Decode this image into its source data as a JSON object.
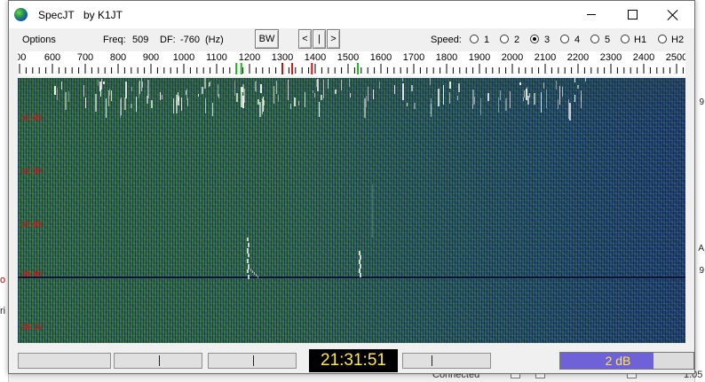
{
  "background": {
    "left_glyph": "ri",
    "left_glyph2": "o",
    "right_glyphs": [
      "9",
      "A",
      "9"
    ],
    "bottom_text": "Connected",
    "bottom_right_text": "1:05"
  },
  "window": {
    "title": "SpecJT",
    "by": "by K1JT",
    "icon": "globe-icon"
  },
  "toolbar": {
    "options_label": "Options",
    "freq_label": "Freq:",
    "freq_value": "509",
    "df_label": "DF:",
    "df_value": "-760",
    "df_unit": "(Hz)",
    "bw_label": "BW",
    "nav": {
      "left": "<",
      "center": "|",
      "right": ">"
    },
    "speed_label": "Speed:",
    "speed_options": [
      "1",
      "2",
      "3",
      "4",
      "5",
      "H1",
      "H2"
    ],
    "speed_selected": "3"
  },
  "scale": {
    "labels": [
      "00",
      "600",
      "700",
      "800",
      "900",
      "1000",
      "1100",
      "1200",
      "1300",
      "1400",
      "1500",
      "1600",
      "1700",
      "1800",
      "1900",
      "2000",
      "2100",
      "2200",
      "2300",
      "2400",
      "2500"
    ],
    "markers": [
      {
        "freq": 1160,
        "color": "#16b816"
      },
      {
        "freq": 1175,
        "color": "#16b816"
      },
      {
        "freq": 1300,
        "color": "#cc1414"
      },
      {
        "freq": 1330,
        "color": "#cc1414"
      },
      {
        "freq": 1390,
        "color": "#cc1414"
      },
      {
        "freq": 1530,
        "color": "#16b816"
      }
    ]
  },
  "waterfall": {
    "time_labels": [
      "31:55",
      "31:30",
      "31:05",
      "30:40",
      "30:15"
    ],
    "colors": {
      "text": "#cc1a1a",
      "signal": "#f2f2f2",
      "divider": "#10143c"
    }
  },
  "status": {
    "clock": "21:31:51",
    "db_value": "2 dB",
    "db_level_percent": 70,
    "colors": {
      "clock_bg": "#000000",
      "clock_fg": "#ffe84a",
      "db_fill": "#6f62d8"
    }
  }
}
